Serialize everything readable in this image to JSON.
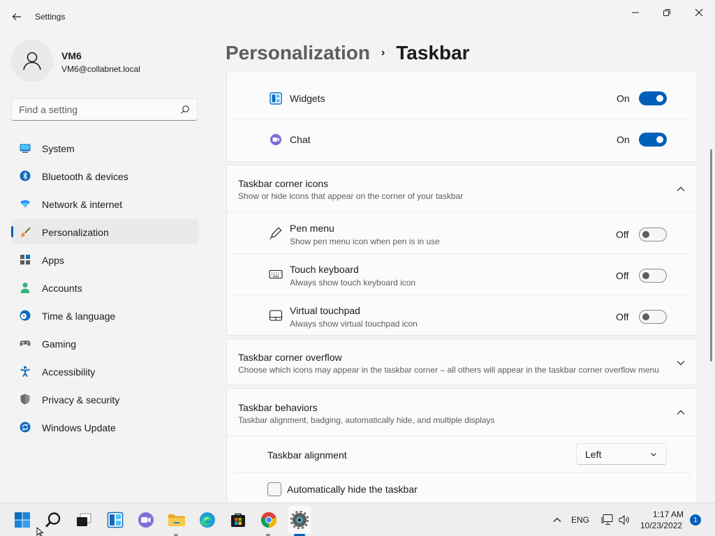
{
  "window": {
    "app_title": "Settings"
  },
  "profile": {
    "name": "VM6",
    "email": "VM6@collabnet.local"
  },
  "search": {
    "placeholder": "Find a setting"
  },
  "nav": {
    "items": [
      {
        "label": "System",
        "icon": "system-icon",
        "active": false
      },
      {
        "label": "Bluetooth & devices",
        "icon": "bluetooth-icon",
        "active": false
      },
      {
        "label": "Network & internet",
        "icon": "wifi-icon",
        "active": false
      },
      {
        "label": "Personalization",
        "icon": "brush-icon",
        "active": true
      },
      {
        "label": "Apps",
        "icon": "apps-icon",
        "active": false
      },
      {
        "label": "Accounts",
        "icon": "accounts-icon",
        "active": false
      },
      {
        "label": "Time & language",
        "icon": "clock-globe-icon",
        "active": false
      },
      {
        "label": "Gaming",
        "icon": "gamepad-icon",
        "active": false
      },
      {
        "label": "Accessibility",
        "icon": "accessibility-icon",
        "active": false
      },
      {
        "label": "Privacy & security",
        "icon": "shield-icon",
        "active": false
      },
      {
        "label": "Windows Update",
        "icon": "update-icon",
        "active": false
      }
    ]
  },
  "breadcrumb": {
    "parent": "Personalization",
    "separator": "›",
    "current": "Taskbar"
  },
  "taskbar_items": {
    "widgets": {
      "label": "Widgets",
      "state": "On"
    },
    "chat": {
      "label": "Chat",
      "state": "On"
    }
  },
  "corner_icons": {
    "title": "Taskbar corner icons",
    "description": "Show or hide icons that appear on the corner of your taskbar",
    "items": [
      {
        "label": "Pen menu",
        "description": "Show pen menu icon when pen is in use",
        "state": "Off"
      },
      {
        "label": "Touch keyboard",
        "description": "Always show touch keyboard icon",
        "state": "Off"
      },
      {
        "label": "Virtual touchpad",
        "description": "Always show virtual touchpad icon",
        "state": "Off"
      }
    ]
  },
  "corner_overflow": {
    "title": "Taskbar corner overflow",
    "description": "Choose which icons may appear in the taskbar corner – all others will appear in the taskbar corner overflow menu"
  },
  "behaviors": {
    "title": "Taskbar behaviors",
    "description": "Taskbar alignment, badging, automatically hide, and multiple displays",
    "alignment_label": "Taskbar alignment",
    "alignment_value": "Left",
    "autohide_label": "Automatically hide the taskbar"
  },
  "system_tray": {
    "language": "ENG",
    "time": "1:17 AM",
    "date": "10/23/2022",
    "notification_count": "1"
  },
  "colors": {
    "accent": "#005fb8",
    "background": "#f3f3f3",
    "card": "#fbfbfb"
  }
}
